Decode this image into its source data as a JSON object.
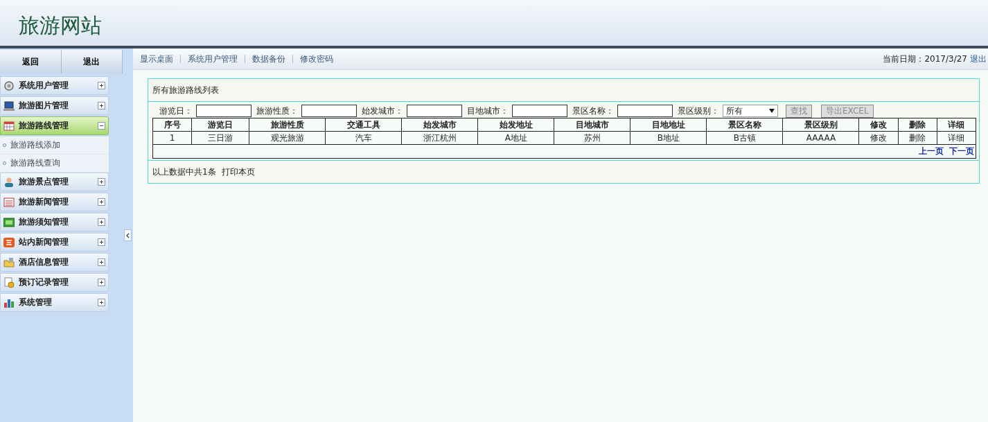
{
  "site_title": "旅游网站",
  "sidebar": {
    "buttons": [
      "返回",
      "退出"
    ],
    "items": [
      {
        "label": "系统用户管理",
        "expanded": false
      },
      {
        "label": "旅游图片管理",
        "expanded": false
      },
      {
        "label": "旅游路线管理",
        "expanded": true,
        "children": [
          {
            "label": "旅游路线添加"
          },
          {
            "label": "旅游路线查询"
          }
        ]
      },
      {
        "label": "旅游景点管理",
        "expanded": false
      },
      {
        "label": "旅游新闻管理",
        "expanded": false
      },
      {
        "label": "旅游须知管理",
        "expanded": false
      },
      {
        "label": "站内新闻管理",
        "expanded": false
      },
      {
        "label": "酒店信息管理",
        "expanded": false
      },
      {
        "label": "预订记录管理",
        "expanded": false
      },
      {
        "label": "系统管理",
        "expanded": false
      }
    ]
  },
  "top_nav": {
    "links": [
      "显示桌面",
      "系统用户管理",
      "数据备份",
      "修改密码"
    ],
    "date_label": "当前日期：2017/3/27",
    "logout": "退出"
  },
  "panel": {
    "title": "所有旅游路线列表",
    "filters": [
      {
        "kind": "text",
        "label": "游览日："
      },
      {
        "kind": "text",
        "label": "旅游性质："
      },
      {
        "kind": "text",
        "label": "始发城市："
      },
      {
        "kind": "text",
        "label": "目地城市："
      },
      {
        "kind": "text",
        "label": "景区名称："
      },
      {
        "kind": "select",
        "label": "景区级别：",
        "value": "所有"
      }
    ],
    "buttons": [
      {
        "label": "查找",
        "disabled": true
      },
      {
        "label": "导出EXCEL",
        "disabled": true
      }
    ],
    "table": {
      "columns": [
        "序号",
        "游览日",
        "旅游性质",
        "交通工具",
        "始发城市",
        "始发地址",
        "目地城市",
        "目地地址",
        "景区名称",
        "景区级别",
        "修改",
        "删除",
        "详细"
      ],
      "rows": [
        [
          "1",
          "三日游",
          "观光旅游",
          "汽车",
          "浙江杭州",
          "A地址",
          "苏州",
          "B地址",
          "B古镇",
          "AAAAA",
          "修改",
          "删除",
          "详细"
        ]
      ]
    },
    "pager": [
      "上一页",
      "下一页"
    ],
    "footer": "以上数据中共1条",
    "print": "打印本页"
  }
}
